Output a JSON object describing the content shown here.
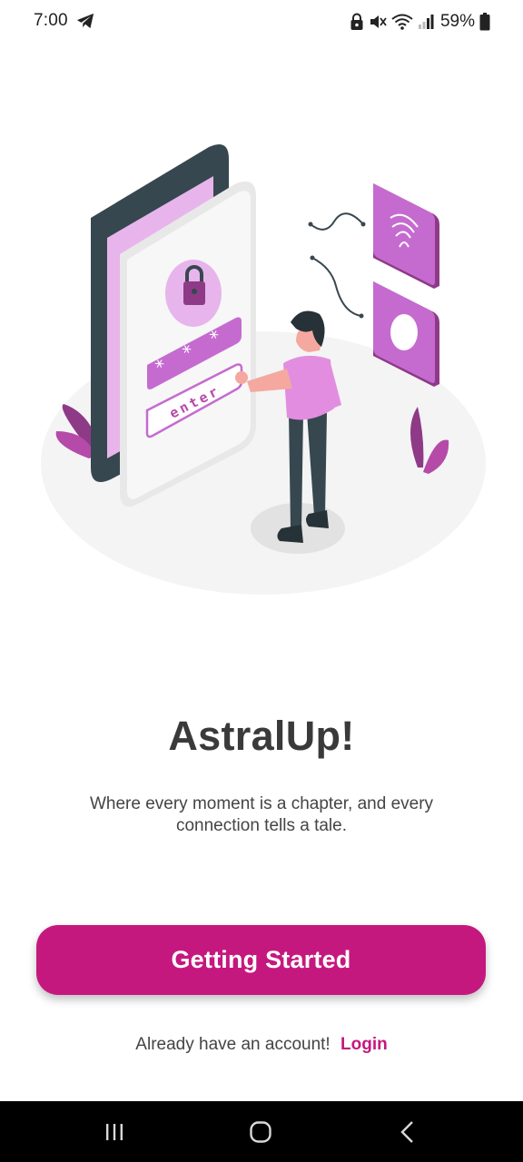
{
  "status_bar": {
    "time": "7:00",
    "battery_percent": "59%",
    "icons": [
      "telegram-icon",
      "lock-icon",
      "mute-icon",
      "wifi-icon",
      "signal-icon",
      "battery-icon"
    ]
  },
  "hero": {
    "illustration": "security-login-illustration",
    "keypad_text": "enter"
  },
  "app_title": "AstralUp!",
  "tagline": "Where every moment is a chapter, and every connection tells a tale.",
  "primary_button": {
    "label": "Getting Started"
  },
  "login_prompt": {
    "text": "Already have an account!",
    "link_label": "Login"
  },
  "nav_bar": {
    "icons": [
      "recent-apps-icon",
      "home-icon",
      "back-icon"
    ]
  },
  "colors": {
    "accent": "#c5187f",
    "illustration_purple": "#c56bd0",
    "dark_slate": "#37474f"
  }
}
